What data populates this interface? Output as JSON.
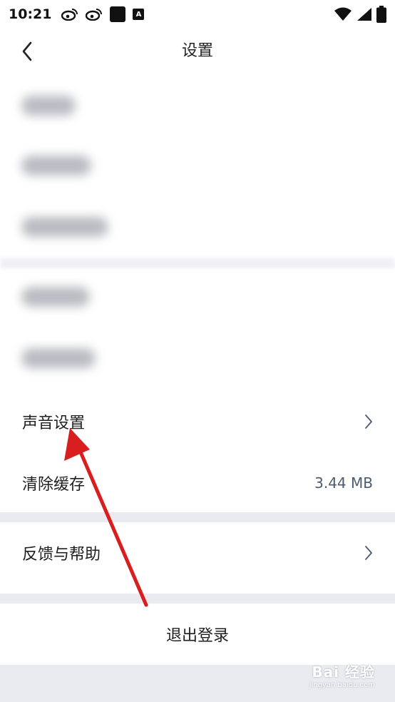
{
  "status_bar": {
    "time": "10:21",
    "app_badge_letter": "A"
  },
  "header": {
    "title": "设置"
  },
  "settings": {
    "sound": {
      "label": "声音设置"
    },
    "cache": {
      "label": "清除缓存",
      "value": "3.44 MB"
    },
    "feedback": {
      "label": "反馈与帮助"
    },
    "logout": {
      "label": "退出登录"
    }
  },
  "watermark": {
    "main": "Bai 经验",
    "sub": "jingyan.baidu.com"
  },
  "colors": {
    "background": "#e9ebf0",
    "card": "#ffffff",
    "cache_value": "#4c5a72",
    "annotation_arrow": "#d81e1e"
  },
  "icons": {
    "back": "chevron-left-icon",
    "row_arrow": "chevron-right-icon",
    "status": [
      "weibo-icon",
      "weibo-icon",
      "app-square-icon",
      "app-a-icon",
      "wifi-icon",
      "signal-icon",
      "battery-icon"
    ]
  }
}
